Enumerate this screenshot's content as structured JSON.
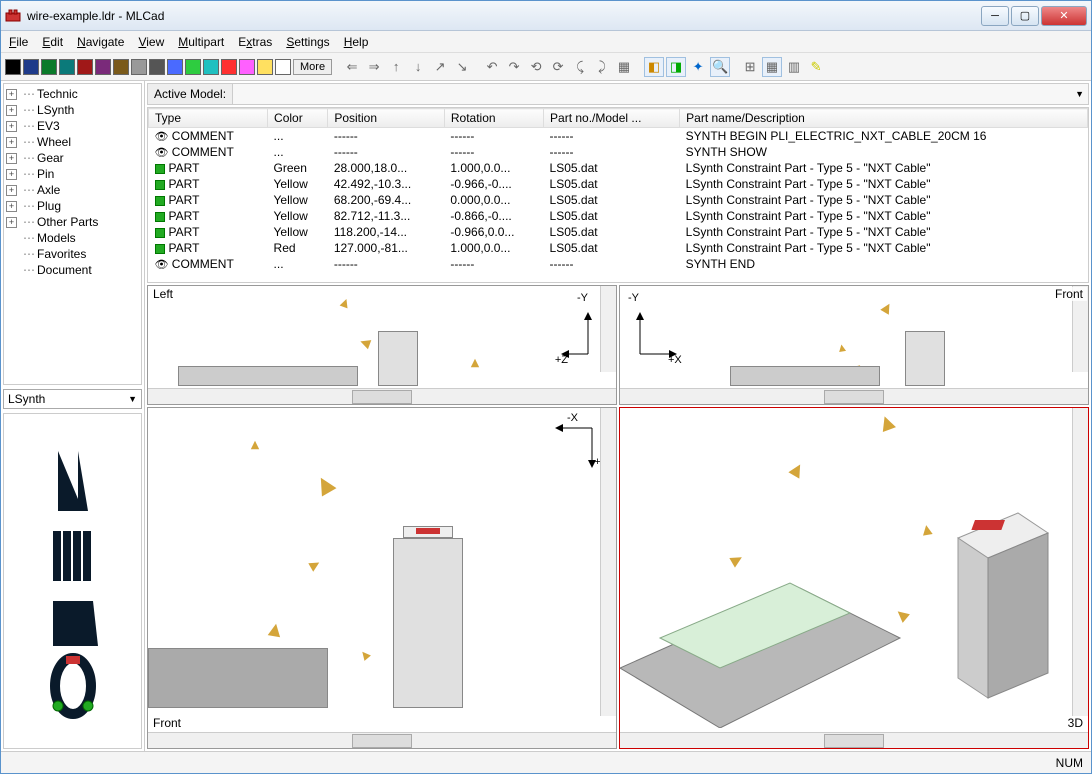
{
  "window": {
    "title": "wire-example.ldr - MLCad"
  },
  "menu": [
    "File",
    "Edit",
    "Navigate",
    "View",
    "Multipart",
    "Extras",
    "Settings",
    "Help"
  ],
  "toolbar": {
    "colors": [
      "#000000",
      "#1e3a8a",
      "#0a7a2a",
      "#0b7a7a",
      "#a01818",
      "#7a2a7a",
      "#7a5a1a",
      "#999999",
      "#555555",
      "#4a6aff",
      "#2ecc40",
      "#20c0c0",
      "#ff3030",
      "#ff60ff",
      "#ffe060",
      "#ffffff"
    ],
    "more_label": "More"
  },
  "tree": [
    {
      "label": "Technic",
      "expandable": true
    },
    {
      "label": "LSynth",
      "expandable": true
    },
    {
      "label": "EV3",
      "expandable": true
    },
    {
      "label": "Wheel",
      "expandable": true
    },
    {
      "label": "Gear",
      "expandable": true
    },
    {
      "label": "Pin",
      "expandable": true
    },
    {
      "label": "Axle",
      "expandable": true
    },
    {
      "label": "Plug",
      "expandable": true
    },
    {
      "label": "Other Parts",
      "expandable": true
    },
    {
      "label": "Models",
      "expandable": false
    },
    {
      "label": "Favorites",
      "expandable": false
    },
    {
      "label": "Document",
      "expandable": false
    }
  ],
  "dropdown": {
    "value": "LSynth"
  },
  "active_model": {
    "label": "Active Model:",
    "value": ""
  },
  "list": {
    "headers": [
      "Type",
      "Color",
      "Position",
      "Rotation",
      "Part no./Model ...",
      "Part name/Description"
    ],
    "rows": [
      {
        "icon": "comment",
        "type": "COMMENT",
        "color": "...",
        "position": "------",
        "rotation": "------",
        "partno": "------",
        "desc": "SYNTH BEGIN PLI_ELECTRIC_NXT_CABLE_20CM 16"
      },
      {
        "icon": "comment",
        "type": "COMMENT",
        "color": "...",
        "position": "------",
        "rotation": "------",
        "partno": "------",
        "desc": "SYNTH SHOW"
      },
      {
        "icon": "part",
        "type": "PART",
        "color": "Green",
        "position": "28.000,18.0...",
        "rotation": "1.000,0.0...",
        "partno": "LS05.dat",
        "desc": "LSynth Constraint Part - Type 5 - \"NXT Cable\""
      },
      {
        "icon": "part",
        "type": "PART",
        "color": "Yellow",
        "position": "42.492,-10.3...",
        "rotation": "-0.966,-0....",
        "partno": "LS05.dat",
        "desc": "LSynth Constraint Part - Type 5 - \"NXT Cable\""
      },
      {
        "icon": "part",
        "type": "PART",
        "color": "Yellow",
        "position": "68.200,-69.4...",
        "rotation": "0.000,0.0...",
        "partno": "LS05.dat",
        "desc": "LSynth Constraint Part - Type 5 - \"NXT Cable\""
      },
      {
        "icon": "part",
        "type": "PART",
        "color": "Yellow",
        "position": "82.712,-11.3...",
        "rotation": "-0.866,-0....",
        "partno": "LS05.dat",
        "desc": "LSynth Constraint Part - Type 5 - \"NXT Cable\""
      },
      {
        "icon": "part",
        "type": "PART",
        "color": "Yellow",
        "position": "118.200,-14...",
        "rotation": "-0.966,0.0...",
        "partno": "LS05.dat",
        "desc": "LSynth Constraint Part - Type 5 - \"NXT Cable\""
      },
      {
        "icon": "part",
        "type": "PART",
        "color": "Red",
        "position": "127.000,-81...",
        "rotation": "1.000,0.0...",
        "partno": "LS05.dat",
        "desc": "LSynth Constraint Part - Type 5 - \"NXT Cable\""
      },
      {
        "icon": "comment",
        "type": "COMMENT",
        "color": "...",
        "position": "------",
        "rotation": "------",
        "partno": "------",
        "desc": "SYNTH END"
      }
    ]
  },
  "viewports": {
    "top_left": {
      "name": "Left",
      "axes": [
        "-Y",
        "+Z"
      ]
    },
    "top_right": {
      "name": "Front",
      "axes": [
        "-Y",
        "+X"
      ]
    },
    "bottom_left": {
      "name": "Front",
      "axes": [
        "-X",
        "+Y"
      ]
    },
    "bottom_right": {
      "name": "3D",
      "axes": []
    }
  },
  "statusbar": {
    "num": "NUM"
  }
}
